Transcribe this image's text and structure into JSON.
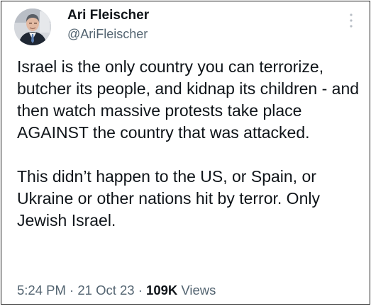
{
  "author": {
    "name": "Ari Fleischer",
    "handle": "@AriFleischer",
    "avatar_icon": "profile-photo"
  },
  "tweet": {
    "paragraphs": [
      "Israel is the only country you can terrorize, butcher its people, and kidnap its children - and then watch massive protests take place AGAINST the country that was attacked.",
      "This didn’t happen to the US, or Spain, or Ukraine or other nations hit by terror. Only Jewish Israel."
    ]
  },
  "meta": {
    "time": "5:24 PM",
    "separator": "·",
    "date": "21 Oct 23",
    "views_count": "109K",
    "views_label": "Views"
  },
  "menu_icon": "more-vertical-icon",
  "colors": {
    "text": "#0f1419",
    "secondary": "#536471",
    "border": "#1a1a1a",
    "background": "#ffffff"
  }
}
